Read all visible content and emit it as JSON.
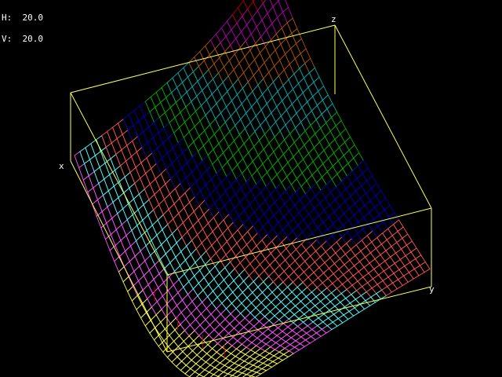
{
  "view": {
    "h_label": "H:",
    "h_value": "20.0",
    "v_label": "V:",
    "v_value": "20.0"
  },
  "axes": {
    "x_label": "x",
    "y_label": "y",
    "z_label": "z"
  },
  "colors": {
    "background": "#000000",
    "box": "#ffff55",
    "bands": [
      "#ffffff",
      "#aa0000",
      "#aa00aa",
      "#aa5500",
      "#00aaaa",
      "#00aa00",
      "#0000aa",
      "#ff5555",
      "#55ffff",
      "#ff55ff",
      "#ffff55"
    ]
  }
}
